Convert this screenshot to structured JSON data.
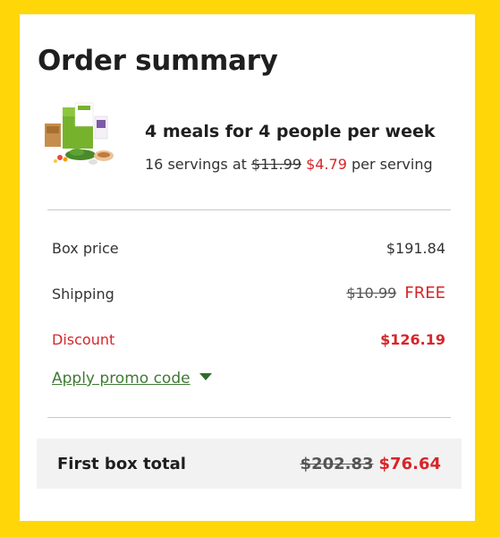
{
  "summary": {
    "title": "Order summary"
  },
  "plan": {
    "title": "4 meals for 4 people per week",
    "servings_prefix": "16 servings at",
    "old_price_per_serving": "$11.99",
    "new_price_per_serving": "$4.79",
    "servings_suffix": "per serving",
    "image_icon": "meal-kit-box-image"
  },
  "rows": {
    "box_price": {
      "label": "Box price",
      "value": "$191.84"
    },
    "shipping": {
      "label": "Shipping",
      "old_value": "$10.99",
      "new_value": "FREE"
    },
    "discount": {
      "label": "Discount",
      "value": "$126.19"
    }
  },
  "promo": {
    "label": "Apply promo code",
    "icon": "caret-down-icon"
  },
  "total": {
    "label": "First box total",
    "old_value": "$202.83",
    "new_value": "$76.64"
  },
  "colors": {
    "background": "#FFD607",
    "card": "#FFFFFF",
    "accent_red": "#D6262A",
    "link_green": "#3F7A34",
    "total_box": "#F2F2F2"
  }
}
